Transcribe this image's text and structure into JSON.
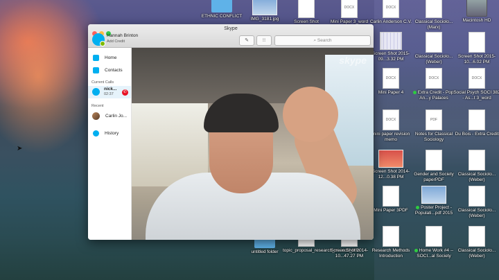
{
  "desktop": {
    "icons": [
      {
        "label": "ETHNIC CONFLICT",
        "type": "folder"
      },
      {
        "label": "IMG_3181.jpg",
        "type": "shot"
      },
      {
        "label": "Screen Shot",
        "type": "doc"
      },
      {
        "label": "Mini Paper 3_word",
        "type": "doc",
        "tag": "DOCX"
      },
      {
        "label": "Carlin Anderson C.V.",
        "type": "doc",
        "tag": "DOCX"
      },
      {
        "label": "Classical Sociolo...(Marx)",
        "type": "doc"
      },
      {
        "label": "Macintosh HD",
        "type": "hd"
      },
      {
        "label": "Screen Shot 2015-09...3.32 PM",
        "type": "grid"
      },
      {
        "label": "Classical Sociolo...(Weber)",
        "type": "doc"
      },
      {
        "label": "Screen Shot 2015-10...6.02 PM",
        "type": "doc"
      },
      {
        "label": "Mini Paper 4",
        "type": "doc",
        "tag": "DOCX"
      },
      {
        "label": "Extra Credit - Pop. An...y Palaces",
        "type": "doc",
        "tag": "DOCX",
        "dot": true
      },
      {
        "label": "Social Psych SOCI 382 - As...t 3_word",
        "type": "doc",
        "tag": "DOCX"
      },
      {
        "label": "mini paper revision memo",
        "type": "doc",
        "tag": "DOCX"
      },
      {
        "label": "Notes for Classical Sociology",
        "type": "doc",
        "tag": "PDF"
      },
      {
        "label": "Du Bois - Extra Credit",
        "type": "doc"
      },
      {
        "label": "Screen Shot 2014-12...0.38 PM",
        "type": "shotred"
      },
      {
        "label": "Gender and Society paperPDF",
        "type": "doc"
      },
      {
        "label": "Classical Sociolo...(Weber)",
        "type": "doc"
      },
      {
        "label": "Mini Paper 3PDF",
        "type": "doc"
      },
      {
        "label": "Poster Project - Populati...pdf 2015",
        "type": "shot",
        "dot": true
      },
      {
        "label": "Classical Sociolo...(Weber)",
        "type": "doc"
      },
      {
        "label": "untitled folder",
        "type": "folder"
      },
      {
        "label": "topic_proposal_research_m...eds_Win",
        "type": "doc",
        "tag": "DOCX"
      },
      {
        "label": "Screen Shot 2014-10...47.27 PM",
        "type": "doc",
        "tag": "DOCX"
      },
      {
        "label": "Research Methods Introduction",
        "type": "doc"
      },
      {
        "label": "Home Work #4 -- SOCI...al Society",
        "type": "doc",
        "dot": true
      },
      {
        "label": "Classical Sociolo...(Weber)",
        "type": "doc"
      }
    ]
  },
  "skype": {
    "window_title": "Skype",
    "user_name": "Hannah Brinton",
    "credit_label": "Add Credit",
    "search_placeholder": "Search",
    "nav": {
      "home": "Home",
      "contacts": "Contacts",
      "history": "History"
    },
    "current_calls_label": "Current Calls",
    "current_call": {
      "name": "nick...",
      "time": "02:37"
    },
    "recent_label": "Recent",
    "recent_contact": "Carlin Jo...",
    "video_logo": "skype"
  }
}
